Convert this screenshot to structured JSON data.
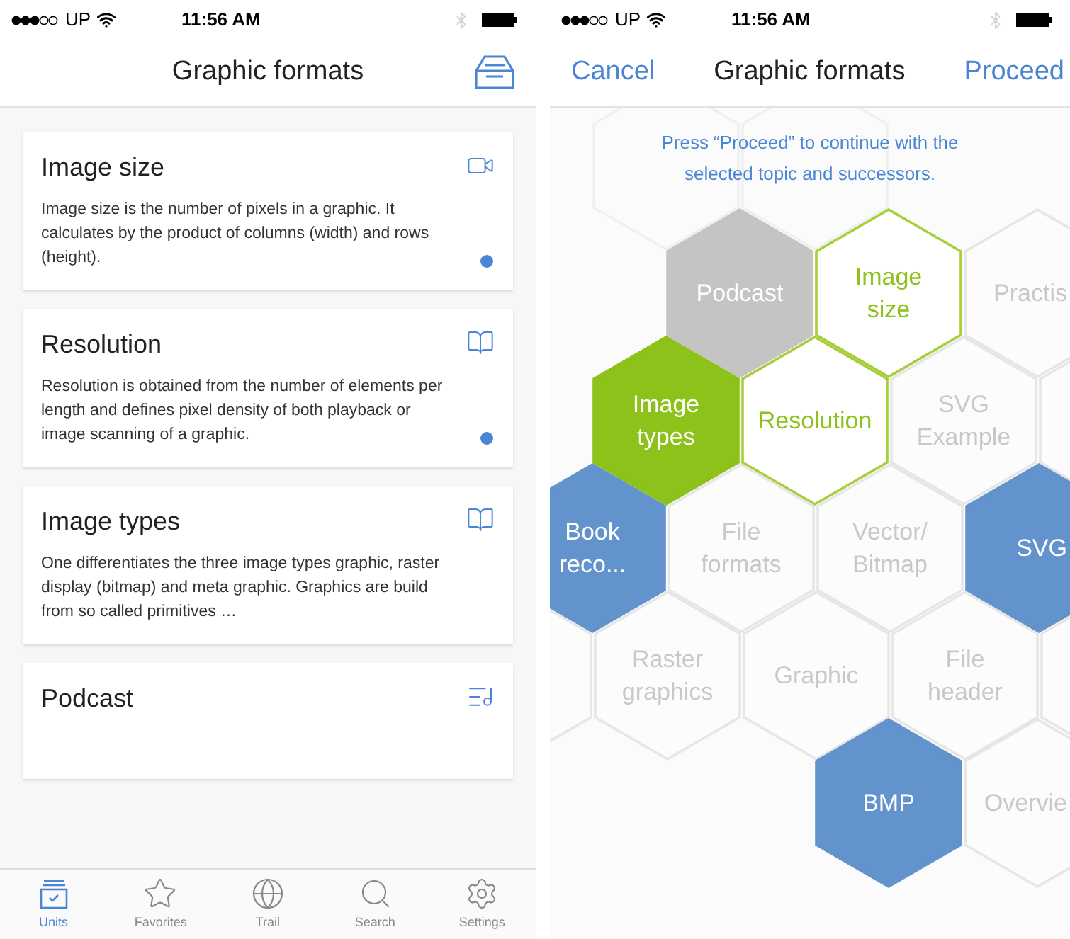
{
  "left_screen": {
    "status_bar": {
      "carrier": "UP",
      "time": "11:56 AM"
    },
    "nav_bar": {
      "title": "Graphic formats"
    },
    "cards": [
      {
        "title": "Image size",
        "body": "Image size is the number of pixels in a graphic. It calculates by the product of columns (width) and rows (height).",
        "kind": "video",
        "unread": true
      },
      {
        "title": "Resolution",
        "body": "Resolution is obtained from the number of elements per length and defines pixel density of both playback or image scanning of a graphic.",
        "kind": "book",
        "unread": true
      },
      {
        "title": "Image types",
        "body": "One differentiates the three image types graphic, raster display (bitmap) and meta graphic. Graphics are build from so called primitives …",
        "kind": "book",
        "unread": false
      },
      {
        "title": "Podcast",
        "kind": "audio",
        "unread": false
      }
    ],
    "tab_bar": [
      {
        "label": "Units",
        "kind": "units",
        "selected": true
      },
      {
        "label": "Favorites",
        "kind": "star",
        "selected": false
      },
      {
        "label": "Trail",
        "kind": "trail",
        "selected": false
      },
      {
        "label": "Search",
        "kind": "search",
        "selected": false
      },
      {
        "label": "Settings",
        "kind": "settings",
        "selected": false
      }
    ]
  },
  "right_screen": {
    "status_bar": {
      "carrier": "UP",
      "time": "11:56 AM"
    },
    "nav_bar": {
      "cancel": "Cancel",
      "title": "Graphic formats",
      "proceed": "Proceed"
    },
    "hint": "Press “Proceed” to continue with the\nselected topic and successors.",
    "hex_rows": [
      [
        {
          "kind": "faint"
        },
        {
          "kind": "faint"
        }
      ],
      [
        {
          "label": "Podcast",
          "kind": "grey"
        },
        {
          "label": "Image\nsize",
          "kind": "outline"
        },
        {
          "label": "Practis",
          "kind": "plain"
        }
      ],
      [
        {
          "label": "Image\ntypes",
          "kind": "green"
        },
        {
          "label": "Resolution",
          "kind": "outline"
        },
        {
          "label": "SVG\nExample",
          "kind": "plain"
        },
        {
          "kind": "plain"
        }
      ],
      [
        {
          "label": "Book\nreco...",
          "kind": "blue"
        },
        {
          "label": "File\nformats",
          "kind": "plain"
        },
        {
          "label": "Vector/\nBitmap",
          "kind": "plain"
        },
        {
          "label": "SVG",
          "kind": "blue"
        }
      ],
      [
        {
          "kind": "plain"
        },
        {
          "label": "Raster\ngraphics",
          "kind": "plain"
        },
        {
          "label": "Graphic",
          "kind": "plain"
        },
        {
          "label": "File\nheader",
          "kind": "plain"
        },
        {
          "kind": "plain"
        }
      ],
      [
        {
          "label": "BMP",
          "kind": "blue"
        },
        {
          "label": "Overvie",
          "kind": "plain"
        }
      ]
    ]
  }
}
